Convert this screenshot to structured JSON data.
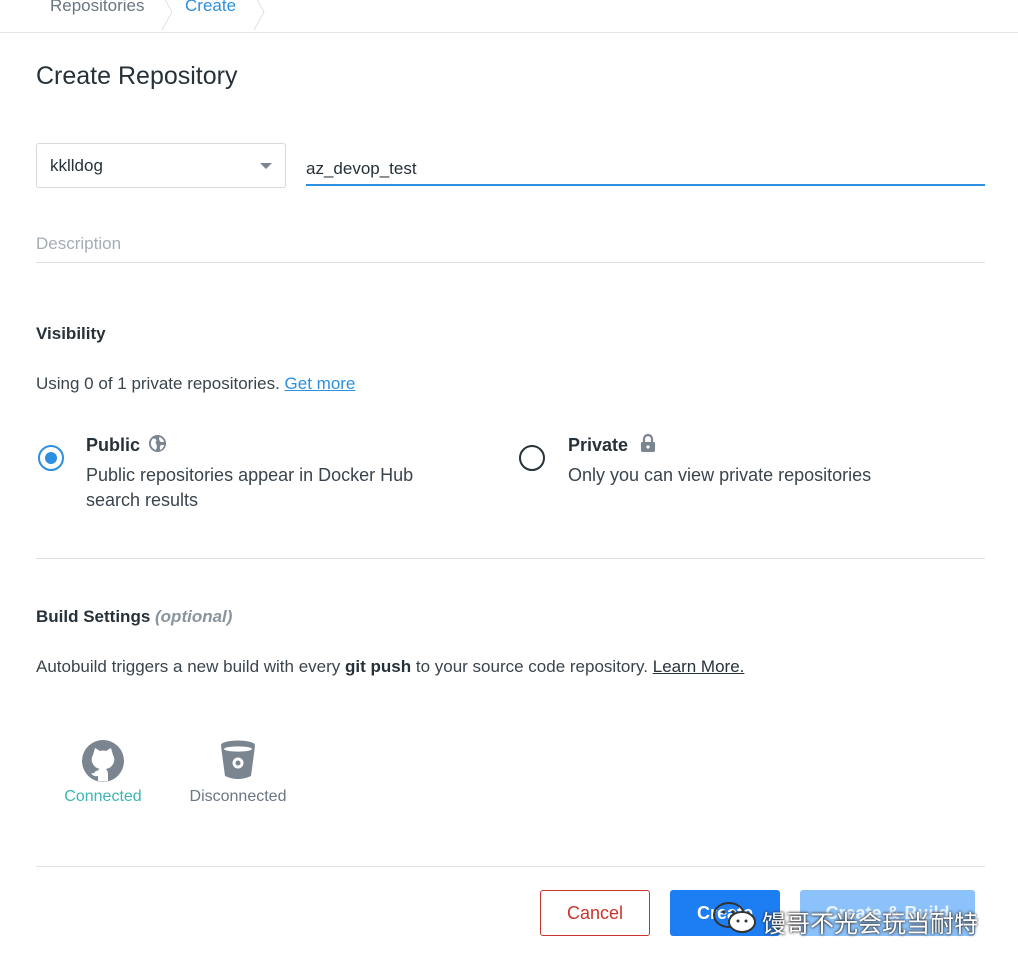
{
  "breadcrumb": {
    "items": [
      "Repositories",
      "Create"
    ]
  },
  "page": {
    "title": "Create Repository"
  },
  "form": {
    "namespace": "kklldog",
    "name": "az_devop_test",
    "description_placeholder": "Description"
  },
  "visibility": {
    "title": "Visibility",
    "usage_text": "Using 0 of 1 private repositories.",
    "usage_link": "Get more",
    "selected": "public",
    "public": {
      "title": "Public",
      "description": "Public repositories appear in Docker Hub search results"
    },
    "private": {
      "title": "Private",
      "description": "Only you can view private repositories"
    }
  },
  "build": {
    "title": "Build Settings",
    "optional": "(optional)",
    "text_before": "Autobuild triggers a new build with every",
    "text_bold": "git push",
    "text_after": "to your source code repository.",
    "link": "Learn More.",
    "providers": [
      {
        "name": "github",
        "status": "Connected",
        "icon": "github-icon"
      },
      {
        "name": "bitbucket",
        "status": "Disconnected",
        "icon": "bitbucket-icon"
      }
    ]
  },
  "actions": {
    "cancel": "Cancel",
    "create": "Create",
    "create_build": "Create & Build"
  },
  "watermark": {
    "text": "馒哥不光会玩当耐特"
  },
  "colors": {
    "accent": "#2d8fdf",
    "primary_button": "#1d7ef4",
    "danger": "#c8342b",
    "connected": "#3ab7b0"
  }
}
